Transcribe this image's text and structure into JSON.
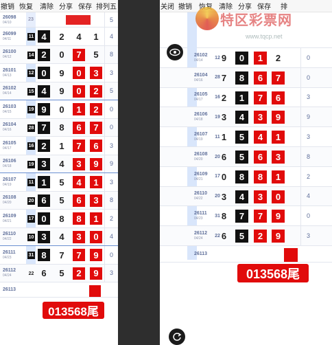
{
  "left": {
    "toolbar": [
      "撤销",
      "恢复",
      "清除",
      "分享",
      "保存",
      "排列五"
    ],
    "topPartial": {
      "period": "26098",
      "date": "04/10",
      "skip": "23",
      "tail": "5"
    },
    "rows": [
      {
        "period": "26099",
        "date": "04/11",
        "skip": "11",
        "digits": [
          "4",
          "2",
          "4",
          "1"
        ],
        "styles": [
          "blk",
          "n",
          "n",
          "n"
        ],
        "tail": "4"
      },
      {
        "period": "26100",
        "date": "04/12",
        "skip": "14",
        "digits": [
          "2",
          "0",
          "7",
          "5"
        ],
        "styles": [
          "blk",
          "n",
          "red",
          "n"
        ],
        "tail": "8"
      },
      {
        "period": "26101",
        "date": "04/13",
        "skip": "12",
        "digits": [
          "0",
          "9",
          "0",
          "3"
        ],
        "styles": [
          "blk",
          "n",
          "red",
          "red"
        ],
        "tail": "3"
      },
      {
        "period": "26102",
        "date": "04/14",
        "skip": "15",
        "digits": [
          "4",
          "9",
          "0",
          "2"
        ],
        "styles": [
          "blk",
          "n",
          "red",
          "red"
        ],
        "tail": "5"
      },
      {
        "period": "26103",
        "date": "04/15",
        "skip": "19",
        "digits": [
          "9",
          "0",
          "1",
          "2"
        ],
        "styles": [
          "blk",
          "n",
          "red",
          "red"
        ],
        "tail": "0"
      },
      {
        "period": "26104",
        "date": "04/16",
        "skip": "28",
        "digits": [
          "7",
          "8",
          "6",
          "7"
        ],
        "styles": [
          "blk",
          "n",
          "red",
          "red"
        ],
        "tail": "0"
      },
      {
        "period": "26105",
        "date": "04/17",
        "skip": "16",
        "digits": [
          "2",
          "1",
          "7",
          "6"
        ],
        "styles": [
          "blk",
          "n",
          "red",
          "red"
        ],
        "tail": "3"
      },
      {
        "period": "26106",
        "date": "04/18",
        "skip": "19",
        "digits": [
          "3",
          "4",
          "3",
          "9"
        ],
        "styles": [
          "blk",
          "n",
          "red",
          "red"
        ],
        "tail": "9"
      },
      {
        "period": "26107",
        "date": "04/19",
        "skip": "11",
        "digits": [
          "1",
          "5",
          "4",
          "1"
        ],
        "styles": [
          "blk",
          "n",
          "red",
          "red"
        ],
        "tail": "3"
      },
      {
        "period": "26108",
        "date": "04/20",
        "skip": "20",
        "digits": [
          "6",
          "5",
          "6",
          "3"
        ],
        "styles": [
          "blk",
          "n",
          "red",
          "red"
        ],
        "tail": "8"
      },
      {
        "period": "26109",
        "date": "04/21",
        "skip": "17",
        "digits": [
          "0",
          "8",
          "8",
          "1"
        ],
        "styles": [
          "blk",
          "n",
          "red",
          "red"
        ],
        "tail": "2"
      },
      {
        "period": "26110",
        "date": "04/22",
        "skip": "10",
        "digits": [
          "3",
          "4",
          "3",
          "0"
        ],
        "styles": [
          "blk",
          "n",
          "red",
          "red"
        ],
        "tail": "4"
      },
      {
        "period": "26111",
        "date": "04/23",
        "skip": "31",
        "digits": [
          "8",
          "7",
          "7",
          "9"
        ],
        "styles": [
          "blk",
          "n",
          "red",
          "red"
        ],
        "tail": "0"
      },
      {
        "period": "26112",
        "date": "04/24",
        "skip": "22",
        "digits": [
          "6",
          "5",
          "2",
          "9"
        ],
        "styles": [
          "n",
          "n",
          "red",
          "red"
        ],
        "tail": "3"
      }
    ],
    "nextPeriod": "26113",
    "annotation": "013568尾"
  },
  "right": {
    "toolbar": [
      "关闭",
      "撤销",
      "恢复",
      "清除",
      "分享",
      "保存",
      "排"
    ],
    "logoText": "特区彩票网",
    "watermark": "www.tqcp.net",
    "rows": [
      {
        "period": "26102",
        "date": "04/14",
        "skip": "12",
        "digits": [
          "9",
          "0",
          "1",
          "2"
        ],
        "styles": [
          "n",
          "blk",
          "red",
          "n"
        ],
        "tail": "0"
      },
      {
        "period": "26104",
        "date": "04/16",
        "skip": "28",
        "digits": [
          "7",
          "8",
          "6",
          "7"
        ],
        "styles": [
          "n",
          "blk",
          "red",
          "red"
        ],
        "tail": "0"
      },
      {
        "period": "26105",
        "date": "04/17",
        "skip": "16",
        "digits": [
          "2",
          "1",
          "7",
          "6"
        ],
        "styles": [
          "n",
          "blk",
          "red",
          "red"
        ],
        "tail": "3"
      },
      {
        "period": "26106",
        "date": "04/18",
        "skip": "19",
        "digits": [
          "3",
          "4",
          "3",
          "9"
        ],
        "styles": [
          "n",
          "blk",
          "red",
          "red"
        ],
        "tail": "9"
      },
      {
        "period": "26107",
        "date": "04/19",
        "skip": "11",
        "digits": [
          "1",
          "5",
          "4",
          "1"
        ],
        "styles": [
          "n",
          "blk",
          "red",
          "red"
        ],
        "tail": "3"
      },
      {
        "period": "26108",
        "date": "04/20",
        "skip": "20",
        "digits": [
          "6",
          "5",
          "6",
          "3"
        ],
        "styles": [
          "n",
          "blk",
          "red",
          "red"
        ],
        "tail": "8"
      },
      {
        "period": "26109",
        "date": "04/21",
        "skip": "17",
        "digits": [
          "0",
          "8",
          "8",
          "1"
        ],
        "styles": [
          "n",
          "blk",
          "red",
          "red"
        ],
        "tail": "2"
      },
      {
        "period": "26110",
        "date": "04/22",
        "skip": "20",
        "digits": [
          "3",
          "4",
          "3",
          "0"
        ],
        "styles": [
          "n",
          "blk",
          "red",
          "red"
        ],
        "tail": "4"
      },
      {
        "period": "26111",
        "date": "04/23",
        "skip": "31",
        "digits": [
          "8",
          "7",
          "7",
          "9"
        ],
        "styles": [
          "n",
          "blk",
          "red",
          "red"
        ],
        "tail": "0"
      },
      {
        "period": "26112",
        "date": "04/24",
        "skip": "22",
        "digits": [
          "6",
          "5",
          "2",
          "9"
        ],
        "styles": [
          "n",
          "blk",
          "red",
          "red"
        ],
        "tail": "3"
      }
    ],
    "nextPeriod": "26113",
    "annotation": "013568尾"
  },
  "icons": {
    "eye": "eye-icon",
    "refresh": "refresh-icon"
  }
}
